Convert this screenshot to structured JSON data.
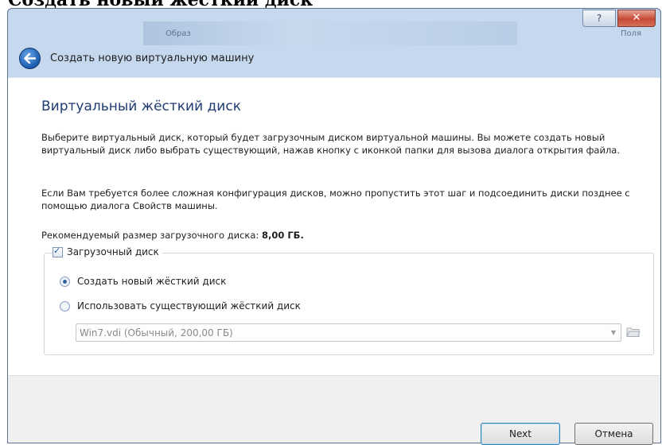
{
  "caption": "Создать новый жёсткий диск",
  "background_window": {
    "label_1": "Образ",
    "label_2": "Поля"
  },
  "title_bar": {
    "help_label": "?",
    "close_label": "✕"
  },
  "header": {
    "title": "Создать новую виртуальную машину"
  },
  "page": {
    "title": "Виртуальный жёсткий диск",
    "paragraph_1": "Выберите виртуальный диск, который будет загрузочным диском виртуальной машины. Вы можете создать новый виртуальный диск либо выбрать существующий, нажав кнопку с иконкой папки для вызова диалога открытия файла.",
    "paragraph_2": "Если Вам требуется более сложная конфигурация дисков, можно пропустить этот шаг и подсоединить диски позднее с помощью диалога Свойств машины.",
    "recommended_label": "Рекомендуемый размер загрузочного диска:",
    "recommended_value": "8,00 ГБ."
  },
  "boot_disk": {
    "checkbox_label": "Загрузочный диск",
    "checked": true,
    "option_create": "Создать новый жёсткий диск",
    "option_existing": "Использовать существующий жёсткий диск",
    "selected_option": "create",
    "existing_disk_value": "Win7.vdi (Обычный, 200,00 ГБ)"
  },
  "buttons": {
    "next": "Next",
    "cancel": "Отмена"
  },
  "icons": {
    "back": "back-arrow-icon",
    "folder": "folder-icon",
    "dropdown": "chevron-down-icon"
  }
}
